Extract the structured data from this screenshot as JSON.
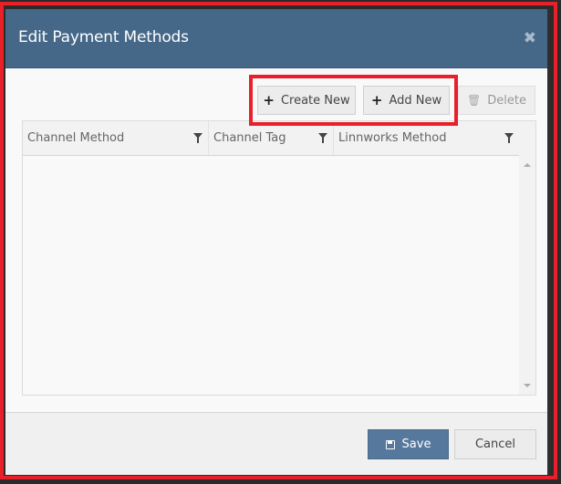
{
  "dialog": {
    "title": "Edit Payment Methods",
    "close_icon": "close-icon"
  },
  "toolbar": {
    "create_new_label": "Create New",
    "add_new_label": "Add New",
    "delete_label": "Delete",
    "create_icon": "plus-icon",
    "add_icon": "plus-icon",
    "delete_icon": "trash-icon"
  },
  "grid": {
    "columns": [
      {
        "label": "Channel Method",
        "icon": "filter-icon"
      },
      {
        "label": "Channel Tag",
        "icon": "filter-icon"
      },
      {
        "label": "Linnworks Method",
        "icon": "filter-icon"
      }
    ],
    "rows": []
  },
  "footer": {
    "save_label": "Save",
    "cancel_label": "Cancel",
    "save_icon": "save-icon"
  },
  "colors": {
    "header": "#456889",
    "save_button": "#56789c",
    "highlight": "#e8202a"
  }
}
